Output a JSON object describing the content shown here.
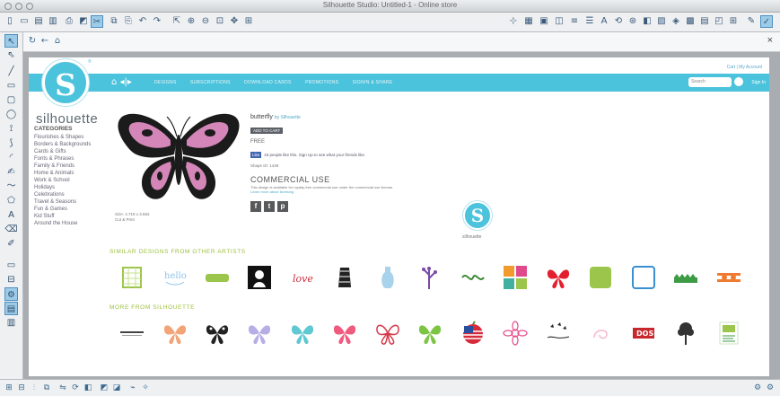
{
  "window": {
    "title": "Silhouette Studio: Untitled-1 - Online store"
  },
  "toolbar_icons": [
    "new-icon",
    "open-icon",
    "save-icon",
    "save-as-icon",
    "print-icon",
    "cut-send-icon",
    "cut-icon",
    "copy-icon",
    "paste-icon",
    "undo-icon",
    "redo-icon",
    "select-icon",
    "zoom-in-icon",
    "zoom-out-icon",
    "zoom-box-icon",
    "pan-icon",
    "fit-page-icon"
  ],
  "toolbar_right_icons": [
    "point-edit-icon",
    "grid-icon",
    "page-setup-icon",
    "cut-settings-icon",
    "line-style-icon",
    "fill-color-icon",
    "text-style-icon",
    "transform-icon",
    "replicate-icon",
    "modify-icon",
    "offset-icon",
    "trace-icon",
    "library-icon",
    "store-icon",
    "layers-icon",
    "grid-settings-icon",
    "print-cut-icon",
    "send-icon"
  ],
  "left_tools": [
    "select-tool",
    "edit-points-tool",
    "line-tool",
    "rectangle-tool",
    "rounded-rectangle-tool",
    "ellipse-tool",
    "polygon-tool",
    "curve-tool",
    "arc-tool",
    "freehand-tool",
    "smooth-freehand-tool",
    "regular-polygon-tool",
    "text-tool",
    "eraser-tool",
    "knife-tool",
    "draw-mode-tool",
    "library-tool",
    "store-tool",
    "design-page-tool",
    "panels-tool"
  ],
  "nav": {
    "back": "←",
    "forward": "→",
    "close": "×"
  },
  "store": {
    "cart_line": "Cart  |  My Account",
    "nav_links": [
      "DESIGNS",
      "SUBSCRIPTIONS",
      "DOWNLOAD CARDS",
      "PROMOTIONS",
      "SIGNIN & SHARE"
    ],
    "search_placeholder": "Search",
    "signin": "Sign In",
    "logo_word": "silhouette",
    "categories_heading": "CATEGORIES",
    "categories": [
      "Flourishes & Shapes",
      "Borders & Backgrounds",
      "Cards & Gifts",
      "Fonts & Phrases",
      "Family & Friends",
      "Home & Animals",
      "Work & School",
      "Holidays",
      "Celebrations",
      "Travel & Seasons",
      "Fun & Games",
      "Kid Stuff",
      "Around the House"
    ],
    "product": {
      "name": "butterfly",
      "by": "by Silhouette",
      "add_btn": "ADD TO CART",
      "price": "FREE",
      "like_btn": "Like",
      "like_text": "43 people like this. Sign Up to see what your friends like.",
      "shape_id": "Shape ID: 1436",
      "size_text": "Size: 4.719 x 3.552",
      "size_note": "Cut & Print",
      "commercial_heading": "COMMERCIAL USE",
      "commercial_text": "This design is available for royalty-free commercial use under the commercial use license.",
      "commercial_link": "Learn more about licensing"
    },
    "right_logo_word": "silhouette",
    "similar_heading": "SIMILAR DESIGNS FROM OTHER ARTISTS",
    "more_heading": "MORE FROM SILHOUETTE",
    "similar_thumbs": [
      "lattice-tag",
      "hello-word-art",
      "green-banner",
      "black-silhouette-square",
      "love-script",
      "pattern-tower",
      "vase-bottle",
      "lavender-plant",
      "green-flourish",
      "colored-squares",
      "red-butterfly",
      "green-scalloped-square",
      "blue-frame",
      "green-grass-border",
      "orange-ribbon"
    ],
    "more_thumbs": [
      "text-strip",
      "orange-butterfly",
      "black-butterfly",
      "purple-butterfly",
      "teal-butterfly",
      "pink-butterfly",
      "red-lace-butterfly",
      "green-butterfly",
      "flag-apple",
      "pink-flower",
      "butterfly-flight",
      "pink-swirl",
      "dos-badge",
      "tree",
      "green-card"
    ]
  },
  "footer_icons": [
    "group-icon",
    "ungroup-icon",
    "align-icon",
    "weld-icon",
    "flip-icon",
    "rotate-icon",
    "arrange-icon",
    "compound-icon",
    "release-icon"
  ],
  "footer_right_icons": [
    "settings-icon",
    "cut-icon-footer"
  ]
}
